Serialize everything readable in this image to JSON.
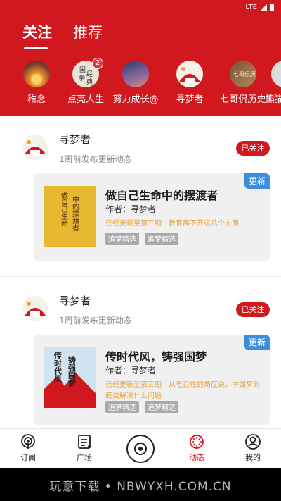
{
  "status_bar": {
    "network": "LTE"
  },
  "tabs": [
    {
      "label": "关注",
      "active": true
    },
    {
      "label": "推荐",
      "active": false
    }
  ],
  "follow_list": [
    {
      "name": "稚念",
      "icon": "sunset-avatar"
    },
    {
      "name": "点亮人生",
      "icon": "books-avatar",
      "badge": "2"
    },
    {
      "name": "努力成长@",
      "icon": "starry-sky-avatar"
    },
    {
      "name": "寻梦者",
      "icon": "dream-seeker-avatar"
    },
    {
      "name": "七哥侃历史",
      "icon": "history-avatar"
    },
    {
      "name": "熊猫",
      "icon": "panda-avatar"
    }
  ],
  "feed": [
    {
      "author": "寻梦者",
      "time": "1周前发布更新动态",
      "follow_label": "已关注",
      "update_tag": "更新",
      "book": {
        "title": "做自己生命中的摆渡者",
        "author": "作者：寻梦者",
        "update": "已经更新至第三期　教育离不开这几个方面",
        "tags": [
          "追梦精选",
          "追梦精选"
        ],
        "cover_text": "做自己生命中的摆渡者"
      }
    },
    {
      "author": "寻梦者",
      "time": "1周前发布更新动态",
      "follow_label": "已关注",
      "update_tag": "更新",
      "book": {
        "title": "传时代风，铸强国梦",
        "author": "作者：寻梦者",
        "update": "已经更新至第三期　从老百姓的角度说，中国梦到底要解决什么问题",
        "tags": [
          "追梦精选",
          "追梦精选"
        ],
        "cover_text": "传时代风铸强国梦"
      }
    }
  ],
  "bottom_nav": [
    {
      "label": "订阅",
      "icon": "podcast-icon"
    },
    {
      "label": "广场",
      "icon": "list-icon"
    },
    {
      "label": "",
      "icon": "disc-icon"
    },
    {
      "label": "动态",
      "icon": "dynamic-icon",
      "active": true
    },
    {
      "label": "我的",
      "icon": "user-icon"
    }
  ],
  "watermark": "玩意下载 • NBWYXH.COM.CN",
  "colors": {
    "brand_red": "#d0181e",
    "update_blue": "#3b8fe0",
    "update_text": "#e9a23b"
  }
}
